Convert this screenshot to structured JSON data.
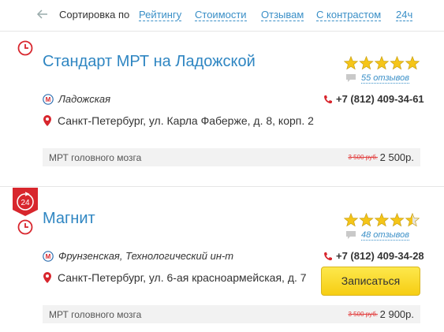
{
  "sort": {
    "label": "Сортировка по",
    "options": [
      "Рейтингу",
      "Стоимости",
      "Отзывам",
      "С контрастом",
      "24ч"
    ]
  },
  "clinics": [
    {
      "title": "Стандарт МРТ на Ладожской",
      "rating": 5,
      "reviews": "55 отзывов",
      "metro": "Ладожская",
      "phone": "+7 (812) 409-34-61",
      "address": "Санкт-Петербург, ул. Карла Фаберже, д. 8, корп. 2",
      "badge_24": false,
      "service": {
        "name": "МРТ головного мозга",
        "old_price": "3 500 руб.",
        "price": "2 500р."
      }
    },
    {
      "title": "Магнит",
      "rating": 4.5,
      "reviews": "48 отзывов",
      "metro": "Фрунзенская, Технологический ин-т",
      "phone": "+7 (812) 409-34-28",
      "address": "Санкт-Петербург, ул. 6-ая красноармейская, д. 7",
      "badge_24": true,
      "badge_text": "24",
      "book_label": "Записаться",
      "service": {
        "name": "МРТ головного мозга",
        "old_price": "3 500 руб.",
        "price": "2 900р."
      }
    }
  ],
  "colors": {
    "link": "#2f86c2",
    "star": "#f5c518",
    "accent_red": "#d8262d",
    "button_yellow": "#f9d72a"
  }
}
